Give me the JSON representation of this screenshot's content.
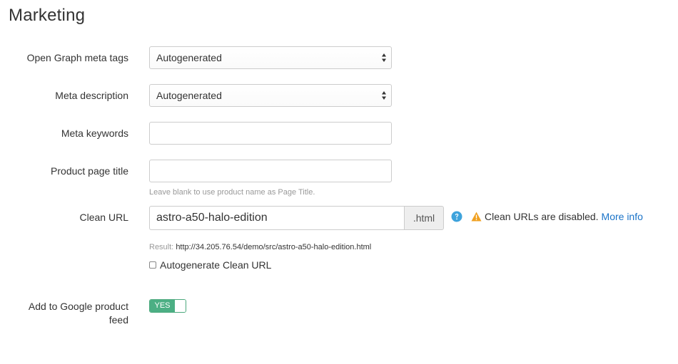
{
  "section": {
    "title": "Marketing"
  },
  "fields": {
    "open_graph": {
      "label": "Open Graph meta tags",
      "selected": "Autogenerated"
    },
    "meta_description": {
      "label": "Meta description",
      "selected": "Autogenerated"
    },
    "meta_keywords": {
      "label": "Meta keywords",
      "value": ""
    },
    "product_page_title": {
      "label": "Product page title",
      "value": "",
      "hint": "Leave blank to use product name as Page Title."
    },
    "clean_url": {
      "label": "Clean URL",
      "value": "astro-a50-halo-edition",
      "suffix": ".html",
      "warning": "Clean URLs are disabled.",
      "more_info": "More info",
      "result_label": "Result:",
      "result_value": "http://34.205.76.54/demo/src/astro-a50-halo-edition.html",
      "autogenerate_label": "Autogenerate Clean URL",
      "autogenerate_checked": false
    },
    "google_feed": {
      "label_line1": "Add to Google product",
      "label_line2": "feed",
      "toggle_label": "YES",
      "enabled": true
    }
  },
  "colors": {
    "toggle_on": "#4caf84",
    "link": "#1a73c8",
    "help_icon": "#3ea3dc",
    "warning_icon": "#f0a020"
  },
  "icons": {
    "select_arrows": "select-arrows-icon",
    "help": "help-circle-icon",
    "warning": "warning-triangle-icon"
  }
}
